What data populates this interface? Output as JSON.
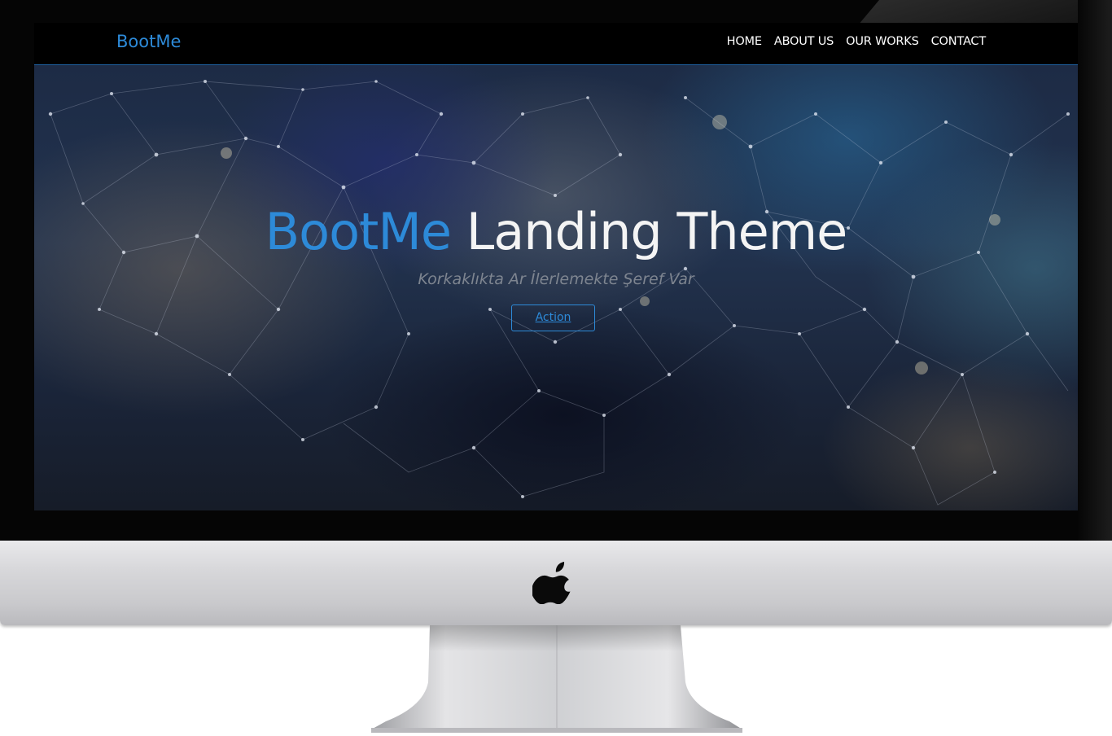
{
  "site": {
    "brand": "BootMe",
    "nav": [
      {
        "label": "HOME"
      },
      {
        "label": "ABOUT US"
      },
      {
        "label": "OUR WORKS"
      },
      {
        "label": "CONTACT"
      }
    ]
  },
  "hero": {
    "title_accent": "BootMe",
    "title_rest": " Landing Theme",
    "subtitle": "Korkaklıkta Ar İlerlemekte Şeref Var",
    "action_label": "Action"
  },
  "colors": {
    "accent": "#2d8ad8",
    "navbar_bg": "#000000",
    "bezel": "#050505",
    "chin": "#d7d7da"
  },
  "icons": {
    "chin_logo": "apple-logo-icon"
  }
}
